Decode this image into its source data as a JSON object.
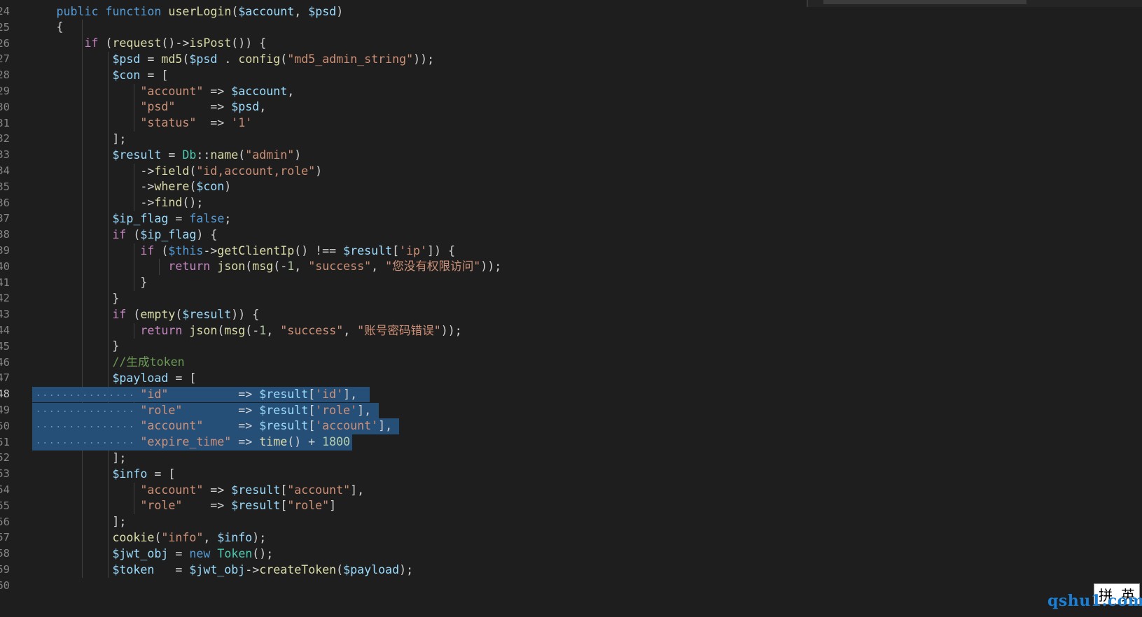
{
  "editor": {
    "line_numbers": [
      "24",
      "25",
      "26",
      "27",
      "28",
      "29",
      "30",
      "31",
      "32",
      "33",
      "34",
      "35",
      "36",
      "37",
      "38",
      "39",
      "40",
      "41",
      "42",
      "43",
      "44",
      "45",
      "46",
      "47",
      "48",
      "49",
      "50",
      "51",
      "52",
      "53",
      "54",
      "55",
      "56",
      "57",
      "58",
      "59",
      "60"
    ],
    "active_line": "48",
    "lines": [
      [
        [
          "kw",
          "public"
        ],
        [
          "op",
          " "
        ],
        [
          "kw",
          "function"
        ],
        [
          "op",
          " "
        ],
        [
          "fn",
          "userLogin"
        ],
        [
          "op",
          "("
        ],
        [
          "var",
          "$account"
        ],
        [
          "op",
          ", "
        ],
        [
          "var",
          "$psd"
        ],
        [
          "op",
          ")"
        ]
      ],
      [
        [
          "op",
          "{"
        ]
      ],
      [
        [
          "op",
          "    "
        ],
        [
          "ctl",
          "if"
        ],
        [
          "op",
          " ("
        ],
        [
          "fn",
          "request"
        ],
        [
          "op",
          "()->"
        ],
        [
          "fn",
          "isPost"
        ],
        [
          "op",
          "()) {"
        ]
      ],
      [
        [
          "op",
          "        "
        ],
        [
          "var",
          "$psd"
        ],
        [
          "op",
          " = "
        ],
        [
          "fn",
          "md5"
        ],
        [
          "op",
          "("
        ],
        [
          "var",
          "$psd"
        ],
        [
          "op",
          " . "
        ],
        [
          "fn",
          "config"
        ],
        [
          "op",
          "("
        ],
        [
          "str",
          "\"md5_admin_string\""
        ],
        [
          "op",
          "));"
        ]
      ],
      [
        [
          "op",
          "        "
        ],
        [
          "var",
          "$con"
        ],
        [
          "op",
          " = ["
        ]
      ],
      [
        [
          "op",
          "            "
        ],
        [
          "str",
          "\"account\""
        ],
        [
          "op",
          " => "
        ],
        [
          "var",
          "$account"
        ],
        [
          "op",
          ","
        ]
      ],
      [
        [
          "op",
          "            "
        ],
        [
          "str",
          "\"psd\""
        ],
        [
          "op",
          "     => "
        ],
        [
          "var",
          "$psd"
        ],
        [
          "op",
          ","
        ]
      ],
      [
        [
          "op",
          "            "
        ],
        [
          "str",
          "\"status\""
        ],
        [
          "op",
          "  => "
        ],
        [
          "str",
          "'1'"
        ]
      ],
      [
        [
          "op",
          "        ];"
        ]
      ],
      [
        [
          "op",
          "        "
        ],
        [
          "var",
          "$result"
        ],
        [
          "op",
          " = "
        ],
        [
          "cls",
          "Db"
        ],
        [
          "op",
          "::"
        ],
        [
          "fn",
          "name"
        ],
        [
          "op",
          "("
        ],
        [
          "str",
          "\"admin\""
        ],
        [
          "op",
          ")"
        ]
      ],
      [
        [
          "op",
          "            ->"
        ],
        [
          "fn",
          "field"
        ],
        [
          "op",
          "("
        ],
        [
          "str",
          "\"id,account,role\""
        ],
        [
          "op",
          ")"
        ]
      ],
      [
        [
          "op",
          "            ->"
        ],
        [
          "fn",
          "where"
        ],
        [
          "op",
          "("
        ],
        [
          "var",
          "$con"
        ],
        [
          "op",
          ")"
        ]
      ],
      [
        [
          "op",
          "            ->"
        ],
        [
          "fn",
          "find"
        ],
        [
          "op",
          "();"
        ]
      ],
      [
        [
          "op",
          "        "
        ],
        [
          "var",
          "$ip_flag"
        ],
        [
          "op",
          " = "
        ],
        [
          "kw",
          "false"
        ],
        [
          "op",
          ";"
        ]
      ],
      [
        [
          "op",
          "        "
        ],
        [
          "ctl",
          "if"
        ],
        [
          "op",
          " ("
        ],
        [
          "var",
          "$ip_flag"
        ],
        [
          "op",
          ") {"
        ]
      ],
      [
        [
          "op",
          "            "
        ],
        [
          "ctl",
          "if"
        ],
        [
          "op",
          " ("
        ],
        [
          "kw",
          "$this"
        ],
        [
          "op",
          "->"
        ],
        [
          "fn",
          "getClientIp"
        ],
        [
          "op",
          "() !== "
        ],
        [
          "var",
          "$result"
        ],
        [
          "op",
          "["
        ],
        [
          "str",
          "'ip'"
        ],
        [
          "op",
          "]) {"
        ]
      ],
      [
        [
          "op",
          "                "
        ],
        [
          "ctl",
          "return"
        ],
        [
          "op",
          " "
        ],
        [
          "fn",
          "json"
        ],
        [
          "op",
          "("
        ],
        [
          "fn",
          "msg"
        ],
        [
          "op",
          "(-"
        ],
        [
          "num",
          "1"
        ],
        [
          "op",
          ", "
        ],
        [
          "str",
          "\"success\""
        ],
        [
          "op",
          ", "
        ],
        [
          "str",
          "\"您没有权限访问\""
        ],
        [
          "op",
          "));"
        ]
      ],
      [
        [
          "op",
          "            }"
        ]
      ],
      [
        [
          "op",
          "        }"
        ]
      ],
      [
        [
          "op",
          "        "
        ],
        [
          "ctl",
          "if"
        ],
        [
          "op",
          " ("
        ],
        [
          "fn",
          "empty"
        ],
        [
          "op",
          "("
        ],
        [
          "var",
          "$result"
        ],
        [
          "op",
          ")) {"
        ]
      ],
      [
        [
          "op",
          "            "
        ],
        [
          "ctl",
          "return"
        ],
        [
          "op",
          " "
        ],
        [
          "fn",
          "json"
        ],
        [
          "op",
          "("
        ],
        [
          "fn",
          "msg"
        ],
        [
          "op",
          "(-"
        ],
        [
          "num",
          "1"
        ],
        [
          "op",
          ", "
        ],
        [
          "str",
          "\"success\""
        ],
        [
          "op",
          ", "
        ],
        [
          "str",
          "\"账号密码错误\""
        ],
        [
          "op",
          "));"
        ]
      ],
      [
        [
          "op",
          "        }"
        ]
      ],
      [
        [
          "op",
          "        "
        ],
        [
          "cmt",
          "//生成token"
        ]
      ],
      [
        [
          "op",
          "        "
        ],
        [
          "var",
          "$payload"
        ],
        [
          "op",
          " = ["
        ]
      ],
      [
        [
          "op",
          "            "
        ],
        [
          "str",
          "\"id\""
        ],
        [
          "op",
          "          => "
        ],
        [
          "var",
          "$result"
        ],
        [
          "op",
          "["
        ],
        [
          "str",
          "'id'"
        ],
        [
          "op",
          "],"
        ]
      ],
      [
        [
          "op",
          "            "
        ],
        [
          "str",
          "\"role\""
        ],
        [
          "op",
          "        => "
        ],
        [
          "var",
          "$result"
        ],
        [
          "op",
          "["
        ],
        [
          "str",
          "'role'"
        ],
        [
          "op",
          "],"
        ]
      ],
      [
        [
          "op",
          "            "
        ],
        [
          "str",
          "\"account\""
        ],
        [
          "op",
          "     => "
        ],
        [
          "var",
          "$result"
        ],
        [
          "op",
          "["
        ],
        [
          "str",
          "'account'"
        ],
        [
          "op",
          "],"
        ]
      ],
      [
        [
          "op",
          "            "
        ],
        [
          "str",
          "\"expire_time\""
        ],
        [
          "op",
          " => "
        ],
        [
          "fn",
          "time"
        ],
        [
          "op",
          "() + "
        ],
        [
          "num",
          "1800"
        ]
      ],
      [
        [
          "op",
          "        ];"
        ]
      ],
      [
        [
          "op",
          "        "
        ],
        [
          "var",
          "$info"
        ],
        [
          "op",
          " = ["
        ]
      ],
      [
        [
          "op",
          "            "
        ],
        [
          "str",
          "\"account\""
        ],
        [
          "op",
          " => "
        ],
        [
          "var",
          "$result"
        ],
        [
          "op",
          "["
        ],
        [
          "str",
          "\"account\""
        ],
        [
          "op",
          "],"
        ]
      ],
      [
        [
          "op",
          "            "
        ],
        [
          "str",
          "\"role\""
        ],
        [
          "op",
          "    => "
        ],
        [
          "var",
          "$result"
        ],
        [
          "op",
          "["
        ],
        [
          "str",
          "\"role\""
        ],
        [
          "op",
          "]"
        ]
      ],
      [
        [
          "op",
          "        ];"
        ]
      ],
      [
        [
          "op",
          "        "
        ],
        [
          "fn",
          "cookie"
        ],
        [
          "op",
          "("
        ],
        [
          "str",
          "\"info\""
        ],
        [
          "op",
          ", "
        ],
        [
          "var",
          "$info"
        ],
        [
          "op",
          ");"
        ]
      ],
      [
        [
          "op",
          "        "
        ],
        [
          "var",
          "$jwt_obj"
        ],
        [
          "op",
          " = "
        ],
        [
          "kw",
          "new"
        ],
        [
          "op",
          " "
        ],
        [
          "cls",
          "Token"
        ],
        [
          "op",
          "();"
        ]
      ],
      [
        [
          "op",
          "        "
        ],
        [
          "var",
          "$token"
        ],
        [
          "op",
          "   = "
        ],
        [
          "var",
          "$jwt_obj"
        ],
        [
          "op",
          "->"
        ],
        [
          "fn",
          "createToken"
        ],
        [
          "op",
          "("
        ],
        [
          "var",
          "$payload"
        ],
        [
          "op",
          ");"
        ]
      ],
      [
        [
          "op",
          ""
        ]
      ]
    ],
    "selected_line_numbers": [
      "48",
      "49",
      "50",
      "51"
    ]
  },
  "ime_indicator": {
    "glyph_left": "拼",
    "glyph_right": "英"
  },
  "watermark": "qshu1.com",
  "colors": {
    "background": "#1e1e1e",
    "selection": "#264f78",
    "keyword": "#569cd6",
    "control": "#c586c0",
    "variable": "#9cdcfe",
    "function": "#dcdcaa",
    "string": "#ce9178",
    "number": "#b5cea8",
    "class": "#4ec9b0",
    "comment": "#6a9955"
  }
}
